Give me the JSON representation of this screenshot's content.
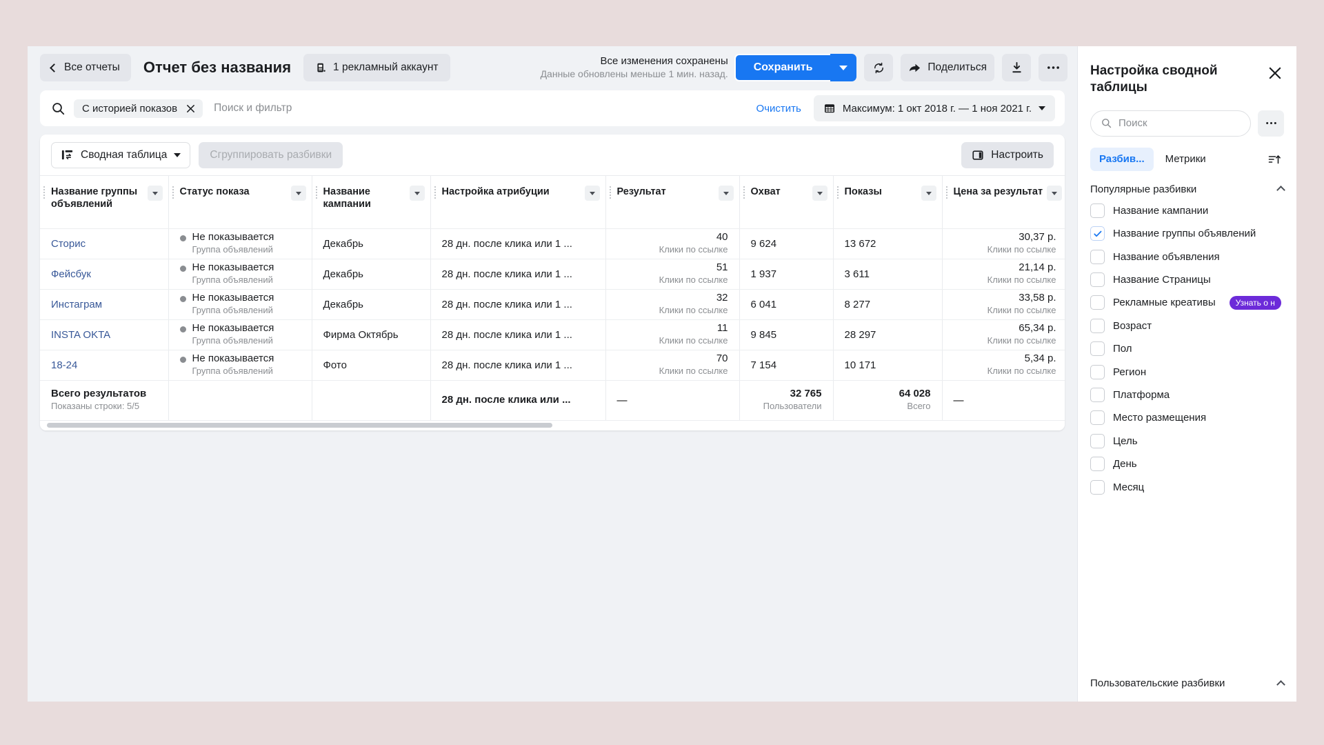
{
  "header": {
    "back_label": "Все отчеты",
    "report_title": "Отчет без названия",
    "account_label": "1 рекламный аккаунт",
    "save_status_line1": "Все изменения сохранены",
    "save_status_line2": "Данные обновлены меньше 1 мин. назад.",
    "save_label": "Сохранить",
    "refresh_icon": "refresh-icon",
    "share_label": "Поделиться",
    "download_icon": "download-icon",
    "more_icon": "ellipsis-icon"
  },
  "filter_bar": {
    "search_icon": "search-icon",
    "active_filter": "С историей показов",
    "remove_filter_icon": "close-icon",
    "placeholder": "Поиск и фильтр",
    "clear_label": "Очистить",
    "calendar_icon": "calendar-icon",
    "date_range": "Максимум: 1 окт 2018 г. — 1 ноя 2021 г."
  },
  "table_toolbar": {
    "pivot_icon": "pivot-table-icon",
    "pivot_label": "Сводная таблица",
    "group_label": "Сгруппировать разбивки",
    "setup_icon": "panel-icon",
    "setup_label": "Настроить"
  },
  "table": {
    "columns": [
      "Название группы объявлений",
      "Статус показа",
      "Название кампании",
      "Настройка атрибуции",
      "Результат",
      "Охват",
      "Показы",
      "Цена за результат"
    ],
    "rows": [
      {
        "name": "Сторис",
        "status": "Не показывается",
        "status_sub": "Группа объявлений",
        "campaign": "Декабрь",
        "attribution": "28 дн. после клика или 1 ...",
        "result": "40",
        "result_sub": "Клики по ссылке",
        "reach": "9 624",
        "impressions": "13 672",
        "cost": "30,37 р.",
        "cost_sub": "Клики по ссылке"
      },
      {
        "name": "Фейсбук",
        "status": "Не показывается",
        "status_sub": "Группа объявлений",
        "campaign": "Декабрь",
        "attribution": "28 дн. после клика или 1 ...",
        "result": "51",
        "result_sub": "Клики по ссылке",
        "reach": "1 937",
        "impressions": "3 611",
        "cost": "21,14 р.",
        "cost_sub": "Клики по ссылке"
      },
      {
        "name": "Инстаграм",
        "status": "Не показывается",
        "status_sub": "Группа объявлений",
        "campaign": "Декабрь",
        "attribution": "28 дн. после клика или 1 ...",
        "result": "32",
        "result_sub": "Клики по ссылке",
        "reach": "6 041",
        "impressions": "8 277",
        "cost": "33,58 р.",
        "cost_sub": "Клики по ссылке"
      },
      {
        "name": "INSTA OKTA",
        "status": "Не показывается",
        "status_sub": "Группа объявлений",
        "campaign": "Фирма Октябрь",
        "attribution": "28 дн. после клика или 1 ...",
        "result": "11",
        "result_sub": "Клики по ссылке",
        "reach": "9 845",
        "impressions": "28 297",
        "cost": "65,34 р.",
        "cost_sub": "Клики по ссылке"
      },
      {
        "name": "18-24",
        "status": "Не показывается",
        "status_sub": "Группа объявлений",
        "campaign": "Фото",
        "attribution": "28 дн. после клика или 1 ...",
        "result": "70",
        "result_sub": "Клики по ссылке",
        "reach": "7 154",
        "impressions": "10 171",
        "cost": "5,34 р.",
        "cost_sub": "Клики по ссылке"
      }
    ],
    "totals": {
      "label": "Всего результатов",
      "rows_shown": "Показаны строки: 5/5",
      "attribution": "28 дн. после клика или ...",
      "result": "—",
      "reach": "32 765",
      "reach_sub": "Пользователи",
      "impressions": "64 028",
      "impressions_sub": "Всего",
      "cost": "—"
    }
  },
  "right_panel": {
    "title": "Настройка сводной таблицы",
    "close_icon": "close-icon",
    "search_icon": "search-icon",
    "search_placeholder": "Поиск",
    "more_icon": "ellipsis-icon",
    "tabs": [
      {
        "label": "Разбив...",
        "active": true
      },
      {
        "label": "Метрики",
        "active": false
      }
    ],
    "sort_icon": "sort-icon",
    "section_popular": "Популярные разбивки",
    "breakdowns": [
      {
        "label": "Название кампании",
        "checked": false,
        "badge": ""
      },
      {
        "label": "Название группы объявлений",
        "checked": true,
        "badge": ""
      },
      {
        "label": "Название объявления",
        "checked": false,
        "badge": ""
      },
      {
        "label": "Название Страницы",
        "checked": false,
        "badge": ""
      },
      {
        "label": "Рекламные креативы",
        "checked": false,
        "badge": "Узнать о н"
      },
      {
        "label": "Возраст",
        "checked": false,
        "badge": ""
      },
      {
        "label": "Пол",
        "checked": false,
        "badge": ""
      },
      {
        "label": "Регион",
        "checked": false,
        "badge": ""
      },
      {
        "label": "Платформа",
        "checked": false,
        "badge": ""
      },
      {
        "label": "Место размещения",
        "checked": false,
        "badge": ""
      },
      {
        "label": "Цель",
        "checked": false,
        "badge": ""
      },
      {
        "label": "День",
        "checked": false,
        "badge": ""
      },
      {
        "label": "Месяц",
        "checked": false,
        "badge": ""
      }
    ],
    "section_custom": "Пользовательские разбивки"
  },
  "colors": {
    "accent": "#1877f2",
    "link": "#385898",
    "badge": "#6c2bd9",
    "page_bg": "#e8dcdc",
    "app_bg": "#f0f2f5"
  }
}
